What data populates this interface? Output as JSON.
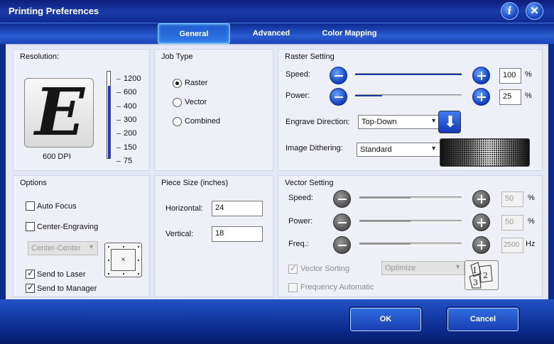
{
  "window": {
    "title": "Printing Preferences"
  },
  "tabs": [
    {
      "label": "General",
      "active": true
    },
    {
      "label": "Advanced"
    },
    {
      "label": "Color Mapping"
    }
  ],
  "resolution": {
    "title": "Resolution:",
    "preview_letter": "E",
    "current": "600 DPI",
    "ticks": [
      "1200",
      "600",
      "400",
      "300",
      "200",
      "150",
      "75"
    ],
    "level_fraction": 0.84
  },
  "job_type": {
    "title": "Job Type",
    "options": [
      "Raster",
      "Vector",
      "Combined"
    ],
    "selected": "Raster"
  },
  "raster": {
    "title": "Raster Setting",
    "speed_label": "Speed:",
    "speed_value": "100",
    "speed_fraction": 1.0,
    "power_label": "Power:",
    "power_value": "25",
    "power_fraction": 0.25,
    "unit": "%",
    "engrave_dir_label": "Engrave Direction:",
    "engrave_dir_value": "Top-Down",
    "dithering_label": "Image Dithering:",
    "dithering_value": "Standard"
  },
  "options": {
    "title": "Options",
    "auto_focus": "Auto Focus",
    "auto_focus_checked": false,
    "center_engraving": "Center-Engraving",
    "center_engraving_checked": false,
    "center_select": "Center-Center",
    "align_mark": "×",
    "send_to_laser": "Send to Laser",
    "send_to_laser_checked": true,
    "send_to_manager": "Send to Manager",
    "send_to_manager_checked": true
  },
  "piece_size": {
    "title": "Piece Size (inches)",
    "horizontal_label": "Horizontal:",
    "horizontal_value": "24",
    "vertical_label": "Vertical:",
    "vertical_value": "18"
  },
  "vector": {
    "title": "Vector Setting",
    "speed_label": "Speed:",
    "speed_value": "50",
    "speed_fraction": 0.5,
    "power_label": "Power:",
    "power_value": "50",
    "power_fraction": 0.5,
    "freq_label": "Freq.:",
    "freq_value": "2500",
    "freq_fraction": 0.5,
    "percent_unit": "%",
    "hz_unit": "Hz",
    "sorting_label": "Vector Sorting",
    "sorting_checked": true,
    "sorting_select": "Optimize",
    "freq_auto_label": "Frequency Automatic",
    "freq_auto_checked": false,
    "sort_icon_digits": [
      "1",
      "2",
      "3"
    ]
  },
  "buttons": {
    "ok": "OK",
    "cancel": "Cancel"
  },
  "colors": {
    "accent": "#1a3aa8",
    "panel": "#eef0f7",
    "title_bar": "#0c1d7a"
  },
  "icons": {
    "info": "info-icon",
    "close": "close-icon",
    "minus": "minus-icon",
    "plus": "plus-icon",
    "direction": "arrow-down-icon",
    "dropdown": "chevron-down-icon"
  }
}
